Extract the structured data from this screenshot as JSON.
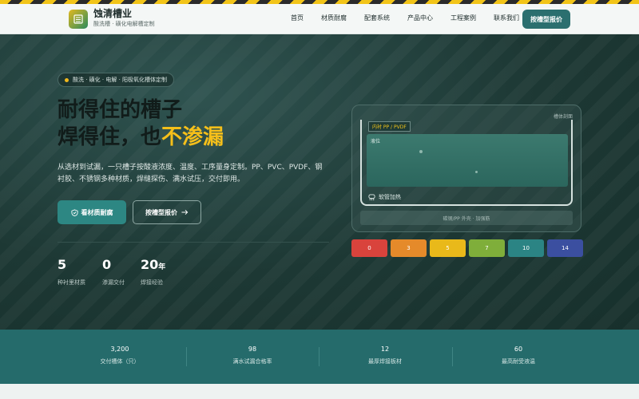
{
  "brand": {
    "title": "蚀清槽业",
    "subtitle": "酸洗槽 · 磺化电解槽定制"
  },
  "nav": [
    "首页",
    "材质耐腐",
    "配套系统",
    "产品中心",
    "工程案例",
    "联系我们"
  ],
  "header_cta": "按槽型报价",
  "hero": {
    "chip": "酸洗 · 磺化 · 电解 · 阳极氧化槽体定制",
    "title_line1": "耐得住的槽子",
    "title_line2_prefix": "焊得住，也",
    "title_line2_highlight": "不渗漏",
    "description": "从选材到试漏，一只槽子按酸液浓度、温度、工序量身定制。PP、PVC、PVDF、钢衬胶、不锈钢多种材质，焊缝探伤、满水试压，交付即用。",
    "btn_primary": "看材质耐腐",
    "btn_secondary": "按槽型报价",
    "stats": [
      {
        "value": "5",
        "unit": "",
        "label": "种衬里材质"
      },
      {
        "value": "0",
        "unit": "",
        "label": "渗漏交付"
      },
      {
        "value": "20",
        "unit": "年",
        "label": "焊接经验"
      }
    ]
  },
  "diagram": {
    "caption": "槽体剖面",
    "lining": "内衬 PP / PVDF",
    "liquid": "液位",
    "heater": "软管加热",
    "base": "碳钢/PP 外壳 · 加强筋"
  },
  "ph_scale": [
    {
      "value": "0",
      "color": "#d9433c"
    },
    {
      "value": "3",
      "color": "#e58a2a"
    },
    {
      "value": "5",
      "color": "#e9b91a"
    },
    {
      "value": "7",
      "color": "#7fae3a"
    },
    {
      "value": "10",
      "color": "#2b8484"
    },
    {
      "value": "14",
      "color": "#3b4fa0"
    }
  ],
  "band_stats": [
    {
      "value": "3,200",
      "label": "交付槽体（只）"
    },
    {
      "value": "98",
      "label": "满水试漏合格率"
    },
    {
      "value": "12",
      "label": "最厚焊接板材"
    },
    {
      "value": "60",
      "label": "最高耐受液温"
    }
  ],
  "colors": {
    "accent": "#f5bf1a",
    "primary": "#2b6f6f",
    "hero_bg": "#1d3834"
  }
}
